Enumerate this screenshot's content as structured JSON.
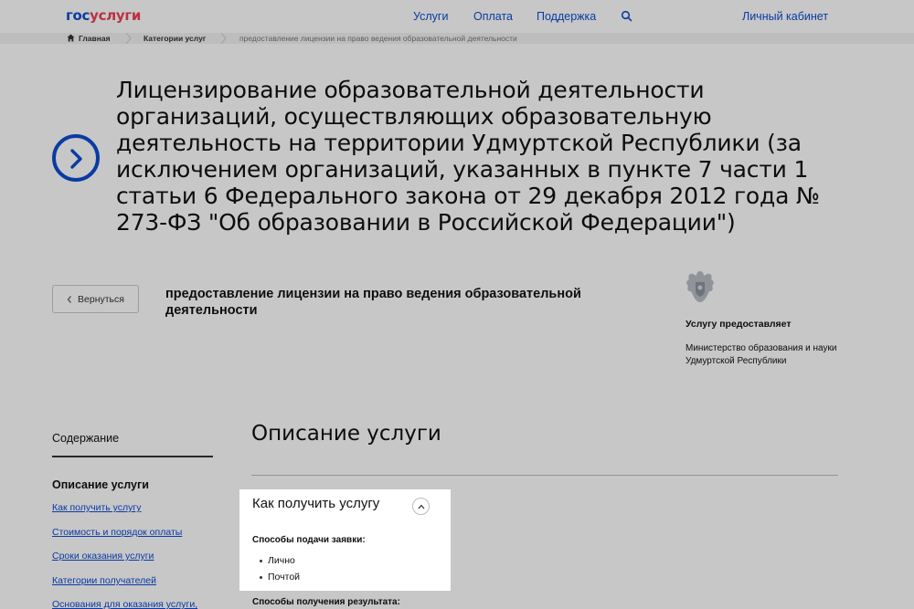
{
  "brand": {
    "logo_part1": "гос",
    "logo_part2": "услуги"
  },
  "nav": {
    "services": "Услуги",
    "payment": "Оплата",
    "support": "Поддержка",
    "cabinet": "Личный кабинет"
  },
  "breadcrumb": {
    "home": "Главная",
    "categories": "Категории услуг",
    "current": "предоставление лицензии на право ведения образовательной деятельности"
  },
  "page": {
    "title": "Лицензирование образовательной деятельности организаций, осуществляющих образовательную деятельность на территории Удмуртской Республики (за исключением организаций, указанных в пункте 7 части 1 статьи 6 Федерального закона от 29 декабря 2012 года № 273-ФЗ \"Об образовании в Российской Федерации\")",
    "back_label": "Вернуться",
    "service_subtitle": "предоставление лицензии на право ведения образовательной деятельности"
  },
  "provider": {
    "label": "Услугу предоставляет",
    "name": "Министерство образования и науки Удмуртской Республики"
  },
  "toc": {
    "title": "Содержание",
    "active": "Описание услуги",
    "links": [
      "Как получить услугу",
      "Стоимость и порядок оплаты",
      "Сроки оказания услуги",
      "Категории получателей",
      "Основания для оказания услуги,"
    ]
  },
  "main": {
    "section_title": "Описание услуги",
    "how_title": "Как получить услугу",
    "methods_label": "Способы подачи заявки:",
    "methods": [
      "Лично",
      "Почтой"
    ],
    "results_label": "Способы получения результата:"
  },
  "colors": {
    "accent": "#0d4cd3",
    "logo_red": "#ee3f58"
  }
}
